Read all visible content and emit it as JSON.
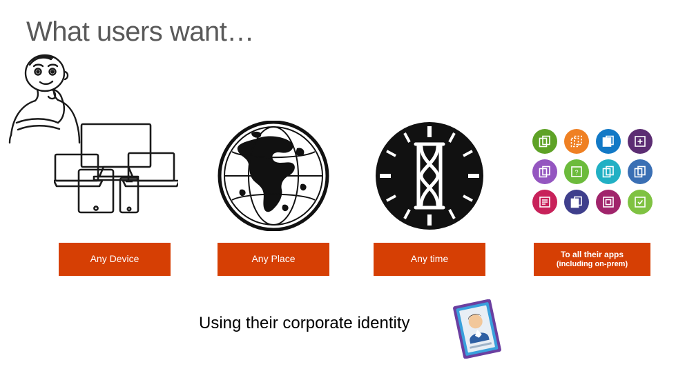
{
  "slide": {
    "title": "What users want…",
    "caption": "Using their corporate identity"
  },
  "labels": [
    {
      "name": "any-device",
      "text": "Any Device"
    },
    {
      "name": "any-place",
      "text": "Any Place"
    },
    {
      "name": "any-time",
      "text": "Any time"
    }
  ],
  "apps_label": {
    "line1": "To all their apps",
    "line2": "(including on-prem)"
  },
  "icons": {
    "person": "thinking-person-icon",
    "devices": "devices-cluster-icon",
    "globe": "globe-icon",
    "clock": "clock-hourglass-icon",
    "badge": "id-badge-icon"
  },
  "colors": {
    "label_background": "#d63f04",
    "label_text": "#ffffff",
    "title_text": "#595959",
    "caption_text": "#000000",
    "slide_background": "#ffffff"
  },
  "app_tiles": [
    {
      "name": "app-tile-1",
      "color": "#5ea226"
    },
    {
      "name": "app-tile-2",
      "color": "#ef8023"
    },
    {
      "name": "app-tile-3",
      "color": "#1279c6"
    },
    {
      "name": "app-tile-4",
      "color": "#5c2d73"
    },
    {
      "name": "app-tile-5",
      "color": "#9456c0"
    },
    {
      "name": "app-tile-6",
      "color": "#6cbb3c"
    },
    {
      "name": "app-tile-7",
      "color": "#21b0c4"
    },
    {
      "name": "app-tile-8",
      "color": "#3a6fb4"
    },
    {
      "name": "app-tile-9",
      "color": "#c8225a"
    },
    {
      "name": "app-tile-10",
      "color": "#3f3f8c"
    },
    {
      "name": "app-tile-11",
      "color": "#a0246b"
    },
    {
      "name": "app-tile-12",
      "color": "#7fc242"
    }
  ]
}
